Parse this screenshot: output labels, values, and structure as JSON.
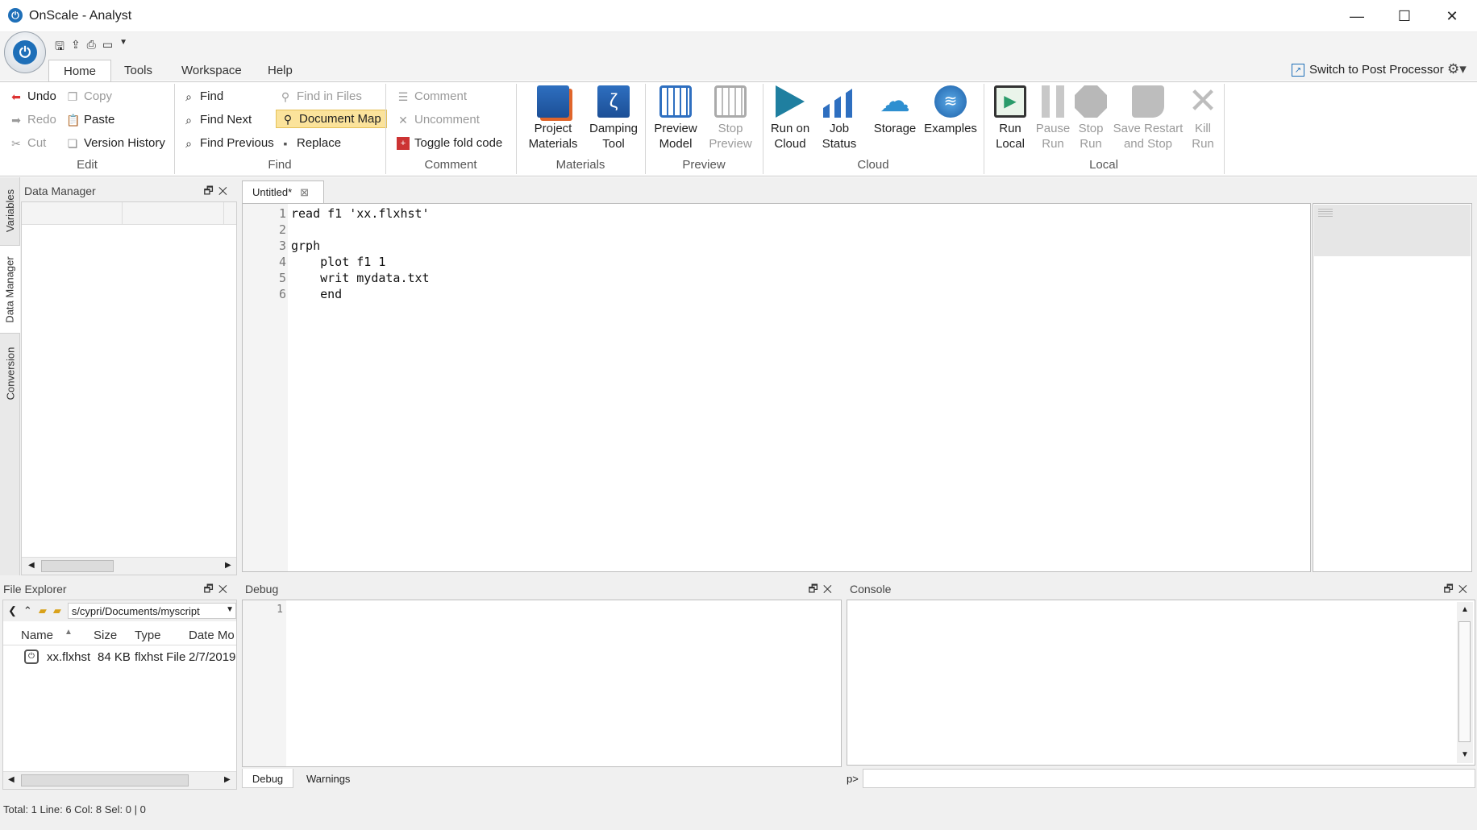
{
  "window": {
    "title": "OnScale - Analyst",
    "minimize": "—",
    "maximize": "☐",
    "close": "✕"
  },
  "ribbon_tabs": [
    "Home",
    "Tools",
    "Workspace",
    "Help"
  ],
  "switch_post": "Switch to Post Processor",
  "edit": {
    "undo": "Undo",
    "redo": "Redo",
    "cut": "Cut",
    "copy": "Copy",
    "paste": "Paste",
    "version_history": "Version History",
    "label": "Edit"
  },
  "find": {
    "find": "Find",
    "find_next": "Find Next",
    "find_previous": "Find Previous",
    "find_in_files": "Find in Files",
    "document_map": "Document Map",
    "replace": "Replace",
    "label": "Find"
  },
  "comment": {
    "comment": "Comment",
    "uncomment": "Uncomment",
    "toggle_fold": "Toggle fold code",
    "label": "Comment"
  },
  "materials": {
    "project_materials": [
      "Project",
      "Materials"
    ],
    "damping_tool": [
      "Damping",
      "Tool"
    ],
    "label": "Materials"
  },
  "preview": {
    "preview_model": [
      "Preview",
      "Model"
    ],
    "stop_preview": [
      "Stop",
      "Preview"
    ],
    "label": "Preview"
  },
  "cloud": {
    "run_on_cloud": [
      "Run on",
      "Cloud"
    ],
    "job_status": [
      "Job",
      "Status"
    ],
    "storage": "Storage",
    "examples": "Examples",
    "label": "Cloud"
  },
  "local": {
    "run_local": [
      "Run",
      "Local"
    ],
    "pause_run": [
      "Pause",
      "Run"
    ],
    "stop_run": [
      "Stop",
      "Run"
    ],
    "save_restart": [
      "Save Restart",
      "and Stop"
    ],
    "kill_run": [
      "Kill",
      "Run"
    ],
    "label": "Local"
  },
  "side_tabs": [
    "Variables",
    "Data Manager",
    "Conversion"
  ],
  "data_manager": {
    "title": "Data Manager"
  },
  "editor": {
    "tab": "Untitled*",
    "lines": [
      "read f1 'xx.flxhst'",
      "",
      "grph",
      "    plot f1 1",
      "    writ mydata.txt",
      "    end"
    ]
  },
  "file_explorer": {
    "title": "File Explorer",
    "path": "s/cypri/Documents/myscript",
    "columns": [
      "Name",
      "Size",
      "Type",
      "Date Mo"
    ],
    "rows": [
      {
        "name": "xx.flxhst",
        "size": "84 KB",
        "type": "flxhst File",
        "date": "2/7/2019"
      }
    ]
  },
  "debug": {
    "title": "Debug",
    "line": "1",
    "tabs": [
      "Debug",
      "Warnings"
    ]
  },
  "console": {
    "title": "Console",
    "prompt": "p>"
  },
  "status": "Total: 1  Line: 6  Col: 8  Sel: 0 | 0"
}
